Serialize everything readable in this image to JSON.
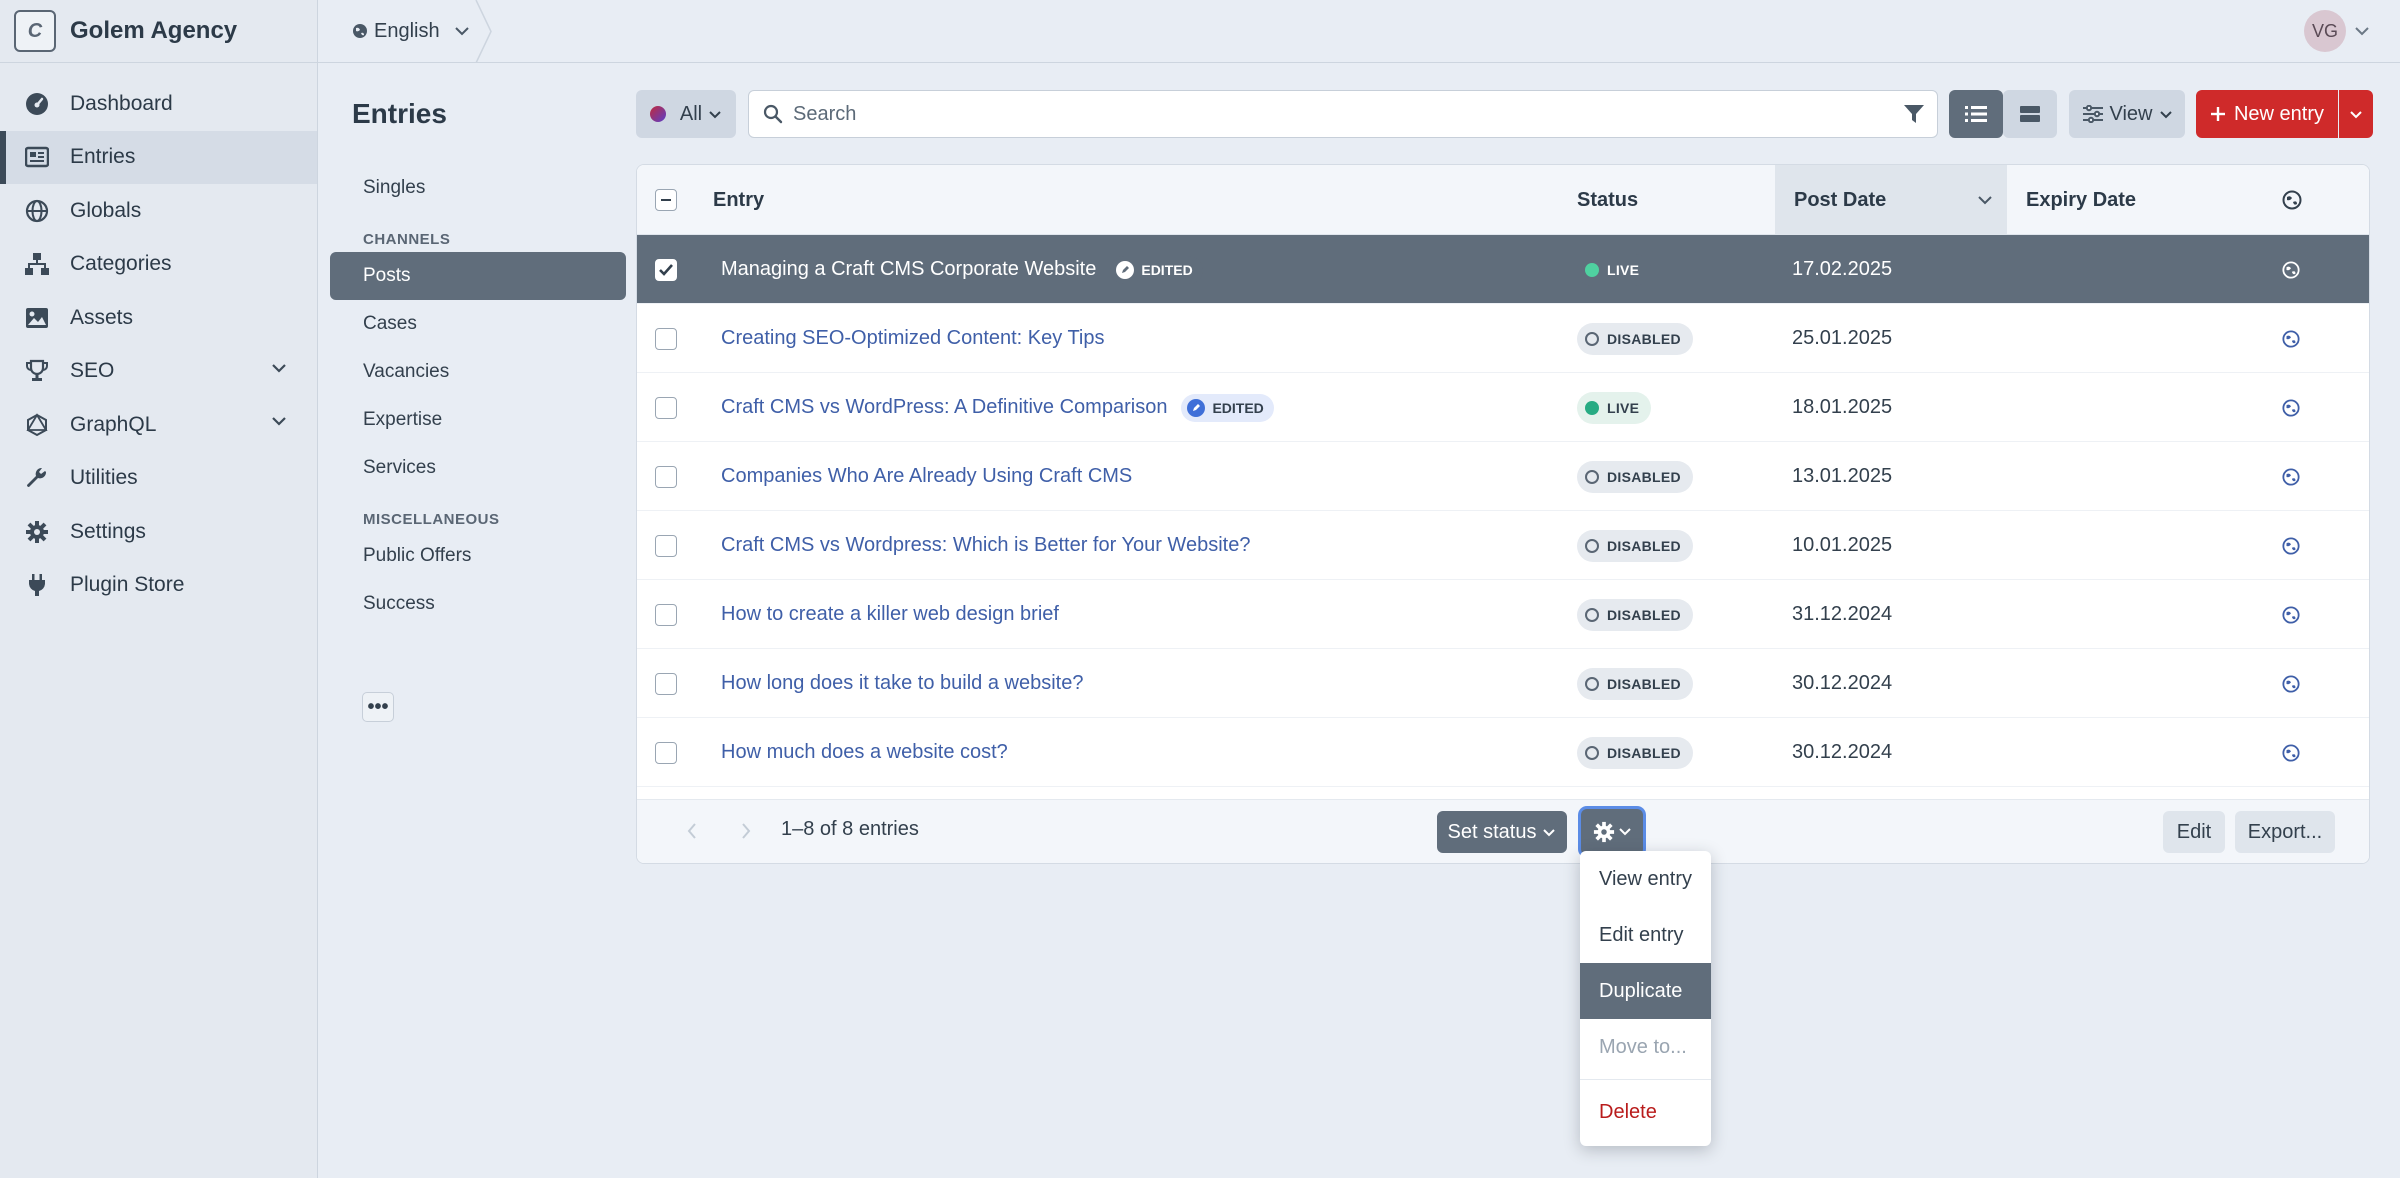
{
  "site": {
    "initial": "C",
    "name": "Golem Agency"
  },
  "nav": {
    "items": [
      {
        "label": "Dashboard",
        "icon": "dashboard-icon"
      },
      {
        "label": "Entries",
        "icon": "entries-icon",
        "active": true
      },
      {
        "label": "Globals",
        "icon": "globe-icon"
      },
      {
        "label": "Categories",
        "icon": "sitemap-icon"
      },
      {
        "label": "Assets",
        "icon": "image-icon"
      },
      {
        "label": "SEO",
        "icon": "trophy-icon",
        "expandable": true
      },
      {
        "label": "GraphQL",
        "icon": "graphql-icon",
        "expandable": true
      },
      {
        "label": "Utilities",
        "icon": "wrench-icon"
      },
      {
        "label": "Settings",
        "icon": "gear-icon"
      },
      {
        "label": "Plugin Store",
        "icon": "plug-icon"
      }
    ]
  },
  "header": {
    "site_label": "English",
    "user_initials": "VG"
  },
  "page": {
    "title": "Entries"
  },
  "sources": {
    "singles": "Singles",
    "channels_heading": "CHANNELS",
    "channels": [
      "Posts",
      "Cases",
      "Vacancies",
      "Expertise",
      "Services"
    ],
    "misc_heading": "MISCELLANEOUS",
    "misc": [
      "Public Offers",
      "Success"
    ],
    "more_label": "•••"
  },
  "toolbar": {
    "status_label": "All",
    "search_placeholder": "Search",
    "view_label": "View",
    "new_entry_label": "New entry"
  },
  "table": {
    "columns": {
      "entry": "Entry",
      "status": "Status",
      "post_date": "Post Date",
      "expiry_date": "Expiry Date"
    },
    "rows": [
      {
        "title": "Managing a Craft CMS Corporate Website",
        "edited": "EDITED",
        "status": "LIVE",
        "post_date": "17.02.2025",
        "selected": true
      },
      {
        "title": "Creating SEO-Optimized Content: Key Tips",
        "edited": "",
        "status": "DISABLED",
        "post_date": "25.01.2025",
        "selected": false
      },
      {
        "title": "Craft CMS vs WordPress: A Definitive Comparison",
        "edited": "EDITED",
        "status": "LIVE",
        "post_date": "18.01.2025",
        "selected": false
      },
      {
        "title": "Companies Who Are Already Using Craft CMS",
        "edited": "",
        "status": "DISABLED",
        "post_date": "13.01.2025",
        "selected": false
      },
      {
        "title": "Craft CMS vs Wordpress: Which is Better for Your Website?",
        "edited": "",
        "status": "DISABLED",
        "post_date": "10.01.2025",
        "selected": false
      },
      {
        "title": "How to create a killer web design brief",
        "edited": "",
        "status": "DISABLED",
        "post_date": "31.12.2024",
        "selected": false
      },
      {
        "title": "How long does it take to build a website?",
        "edited": "",
        "status": "DISABLED",
        "post_date": "30.12.2024",
        "selected": false
      },
      {
        "title": "How much does a website cost?",
        "edited": "",
        "status": "DISABLED",
        "post_date": "30.12.2024",
        "selected": false
      }
    ]
  },
  "footer": {
    "pagination": "1–8 of 8 entries",
    "set_status_label": "Set status",
    "edit_label": "Edit",
    "export_label": "Export..."
  },
  "actions_menu": {
    "items": [
      {
        "label": "View entry",
        "state": "normal"
      },
      {
        "label": "Edit entry",
        "state": "normal"
      },
      {
        "label": "Duplicate",
        "state": "hover"
      },
      {
        "label": "Move to...",
        "state": "disabled"
      },
      {
        "label": "Delete",
        "state": "danger"
      }
    ]
  },
  "colors": {
    "accent": "#cf2a2a",
    "selected_row": "#606d7b",
    "live": "#27ab83",
    "link": "#3f5fa8"
  }
}
